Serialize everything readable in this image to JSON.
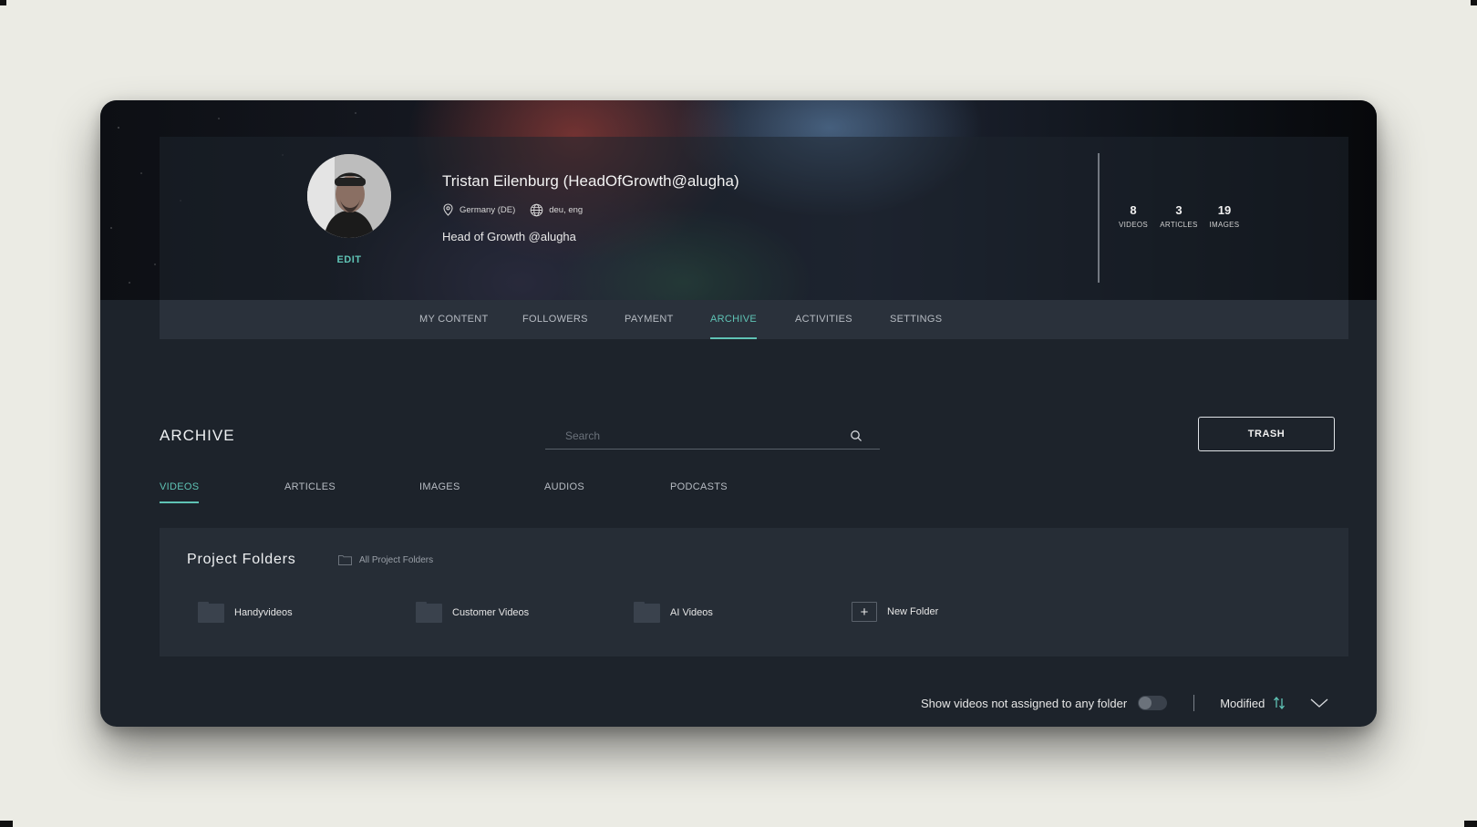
{
  "profile": {
    "name": "Tristan Eilenburg (HeadOfGrowth@alugha)",
    "location": "Germany (DE)",
    "languages": "deu, eng",
    "bio": "Head of Growth @alugha",
    "edit_label": "EDIT",
    "stats": [
      {
        "value": "8",
        "label": "VIDEOS"
      },
      {
        "value": "3",
        "label": "ARTICLES"
      },
      {
        "value": "19",
        "label": "IMAGES"
      }
    ]
  },
  "nav": {
    "items": [
      {
        "label": "MY CONTENT"
      },
      {
        "label": "FOLLOWERS"
      },
      {
        "label": "PAYMENT"
      },
      {
        "label": "ARCHIVE",
        "active": true
      },
      {
        "label": "ACTIVITIES"
      },
      {
        "label": "SETTINGS"
      }
    ]
  },
  "archive": {
    "title": "ARCHIVE",
    "search_placeholder": "Search",
    "trash_label": "TRASH",
    "tabs": [
      {
        "label": "VIDEOS",
        "active": true
      },
      {
        "label": "ARTICLES"
      },
      {
        "label": "IMAGES"
      },
      {
        "label": "AUDIOS"
      },
      {
        "label": "PODCASTS"
      }
    ]
  },
  "folders": {
    "title": "Project Folders",
    "all_label": "All Project Folders",
    "items": [
      {
        "label": "Handyvideos"
      },
      {
        "label": "Customer Videos"
      },
      {
        "label": "AI Videos"
      }
    ],
    "new_label": "New Folder"
  },
  "footer": {
    "unassigned_label": "Show videos not assigned to any folder",
    "unassigned_toggle_on": false,
    "sort_label": "Modified"
  },
  "colors": {
    "accent": "#5fc3b5",
    "page_background": "#ebebe4",
    "panel": "#1d232b"
  }
}
